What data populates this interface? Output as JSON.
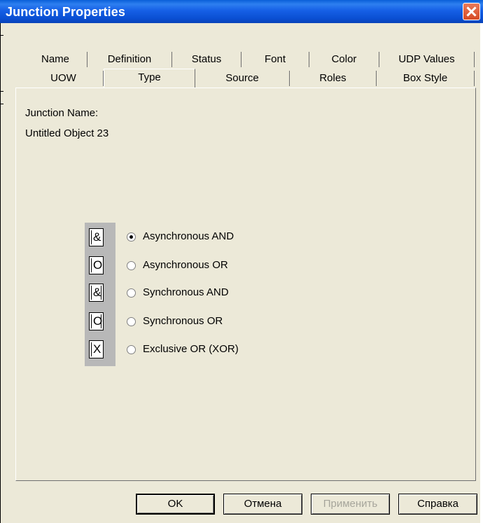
{
  "window": {
    "title": "Junction Properties"
  },
  "tabs_row1": [
    "Name",
    "Definition",
    "Status",
    "Font",
    "Color",
    "UDP Values"
  ],
  "tabs_row2": [
    "UOW",
    "Type",
    "Source",
    "Roles",
    "Box Style"
  ],
  "active_tab": "Type",
  "junction": {
    "name_label": "Junction Name:",
    "name_value": "Untitled Object 23"
  },
  "types": [
    {
      "symbol": "&",
      "label": "Asynchronous AND",
      "checked": true
    },
    {
      "symbol": "O",
      "label": "Asynchronous OR",
      "checked": false
    },
    {
      "symbol": "&",
      "label": "Synchronous AND",
      "checked": false
    },
    {
      "symbol": "O",
      "label": "Synchronous OR",
      "checked": false
    },
    {
      "symbol": "X",
      "label": "Exclusive OR (XOR)",
      "checked": false
    }
  ],
  "buttons": {
    "ok": "OK",
    "cancel": "Отмена",
    "apply": "Применить",
    "help": "Справка"
  }
}
